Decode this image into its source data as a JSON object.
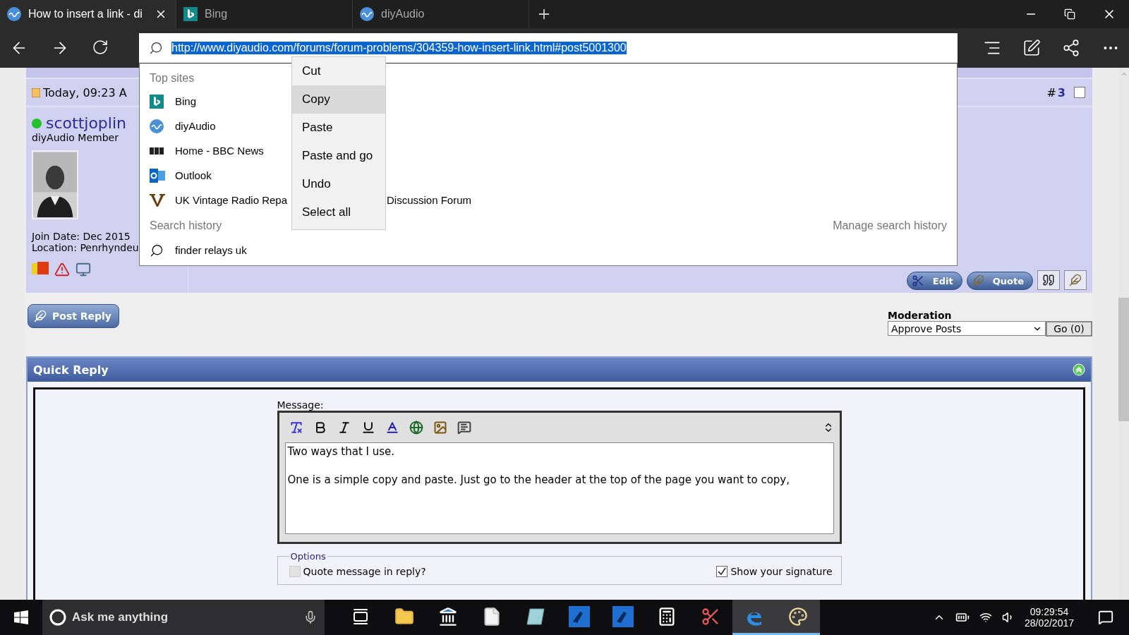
{
  "browser": {
    "tabs": [
      {
        "title": "How to insert a link - di",
        "selected": true,
        "closable": true
      },
      {
        "title": "Bing",
        "selected": false,
        "closable": false
      },
      {
        "title": "diyAudio",
        "selected": false,
        "closable": false
      }
    ],
    "address": {
      "value": "http://www.diyaudio.com/forums/forum-problems/304359-how-insert-link.html#post5001300",
      "selected": true
    }
  },
  "address_dropdown": {
    "top_sites_heading": "Top sites",
    "top_sites": [
      {
        "label": "Bing"
      },
      {
        "label": "diyAudio"
      },
      {
        "label": "Home - BBC News"
      },
      {
        "label": "Outlook"
      },
      {
        "label": "UK Vintage Radio Repa",
        "label_end": "Discussion Forum"
      }
    ],
    "search_history_heading": "Search history",
    "manage_link": "Manage search history",
    "history": [
      "finder relays uk"
    ]
  },
  "context_menu": [
    {
      "label": "Cut",
      "selected": false
    },
    {
      "label": "Copy",
      "selected": true
    },
    {
      "label": "Paste",
      "selected": false
    },
    {
      "label": "Paste and go",
      "selected": false
    },
    {
      "label": "Undo",
      "selected": false
    },
    {
      "label": "Select all",
      "selected": false
    }
  ],
  "post": {
    "date": "Today, 09:23 A",
    "number_mark": "#",
    "number": "3",
    "checked": false,
    "author": {
      "name": "scottjoplin",
      "online": true,
      "rank": "diyAudio Member",
      "join_date": "Join Date: Dec 2015",
      "location": "Location: Penrhyndeu"
    },
    "buttons": [
      {
        "kind": "labeled",
        "label": "Edit"
      },
      {
        "kind": "labeled",
        "label": "Quote"
      },
      {
        "kind": "icon"
      },
      {
        "kind": "icon"
      }
    ]
  },
  "post_reply": "Post Reply",
  "moderation": {
    "label": "Moderation",
    "value": "Approve Posts",
    "button": "Go (0)"
  },
  "quick_reply": {
    "title": "Quick Reply",
    "message_label": "Message:",
    "text": "Two ways that I use.\n\nOne is a simple copy and paste. Just go to the header at the top of the page you want to copy,",
    "options_legend": "Options",
    "options": [
      {
        "label": "Quote message in reply?",
        "checked": false,
        "disabled": true
      },
      {
        "label": "Show your signature",
        "checked": true,
        "disabled": false
      }
    ]
  },
  "taskbar": {
    "search_placeholder": "Ask me anything",
    "apps": [
      {
        "selected": false
      },
      {
        "selected": false
      },
      {
        "selected": false
      },
      {
        "selected": false
      },
      {
        "selected": false
      },
      {
        "selected": false
      },
      {
        "selected": false
      },
      {
        "selected": false
      },
      {
        "selected": false
      },
      {
        "selected": true
      },
      {
        "selected": true
      }
    ],
    "time": "09:29:54",
    "date": "28/02/2017"
  }
}
